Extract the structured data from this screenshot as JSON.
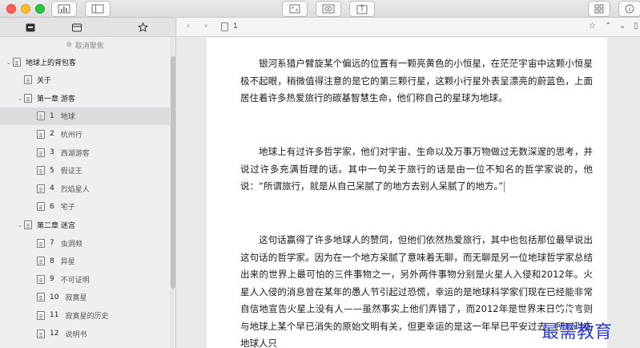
{
  "sidebar": {
    "unfocus_label": "取消聚焦",
    "tree": [
      {
        "label": "地球上的背包客",
        "level": 0,
        "chevron": "⌄",
        "selected": false
      },
      {
        "label": "关于",
        "level": 1,
        "chevron": "",
        "selected": false
      },
      {
        "label": "第一章 游客",
        "level": 1,
        "chevron": "⌄",
        "selected": false
      },
      {
        "num": "1",
        "label": "地球",
        "level": 2,
        "chevron": "",
        "selected": true
      },
      {
        "num": "2",
        "label": "杭州行",
        "level": 2,
        "chevron": "",
        "selected": false
      },
      {
        "num": "3",
        "label": "西湖游客",
        "level": 2,
        "chevron": "",
        "selected": false
      },
      {
        "num": "5",
        "label": "假证王",
        "level": 2,
        "chevron": "",
        "selected": false
      },
      {
        "num": "4",
        "label": "烈焰星人",
        "level": 2,
        "chevron": "",
        "selected": false
      },
      {
        "num": "6",
        "label": "宅子",
        "level": 2,
        "chevron": "",
        "selected": false
      },
      {
        "label": "第二章 迷宫",
        "level": 1,
        "chevron": "⌄",
        "selected": false
      },
      {
        "num": "7",
        "label": "虫洞频",
        "level": 2,
        "chevron": "",
        "selected": false
      },
      {
        "num": "8",
        "label": "异星",
        "level": 2,
        "chevron": "",
        "selected": false
      },
      {
        "num": "9",
        "label": "不可证明",
        "level": 2,
        "chevron": "",
        "selected": false
      },
      {
        "num": "10",
        "label": "寂寞星",
        "level": 2,
        "chevron": "",
        "selected": false
      },
      {
        "num": "11",
        "label": "寂寞星的历史",
        "level": 2,
        "chevron": "",
        "selected": false
      },
      {
        "num": "12",
        "label": "说明书",
        "level": 2,
        "chevron": "",
        "selected": false
      }
    ]
  },
  "editor": {
    "page_number": "1",
    "paragraphs": [
      "银河系猎户臂旋某个偏远的位置有一颗亮黄色的小恒星，在茫茫宇宙中这颗小恒星极不起眼，稍微值得注意的是它的第三颗行星，这颗小行星外表呈漂亮的蔚蓝色，上面居住着许多热爱旅行的碳基智慧生命，他们称自己的星球为地球。",
      "地球上有过许多哲学家，他们对宇宙、生命以及万事万物做过无数深邃的思考，并说过许多充满哲理的话。其中一句关于旅行的话是由一位不知名的哲学家说的，他说：“所谓旅行，就是从自己呆腻了的地方去别人呆腻了的地方。”",
      "这句话赢得了许多地球人的赞同，但他们依然热爱旅行，其中也包括那位最早说出这句话的哲学家。因为在一个地方呆腻了意味着无聊，而无聊是另一位地球哲学家总结出来的世界上最可怕的三件事物之一，另外两件事物分别是火星人入侵和2012年。火星人入侵的消息曾在某年的愚人节引起过恐慌，幸运的是地球科学家们现在已经能非常自信地宣告火星上没有人——虽然事实上他们弄错了，而2012年是世界末日的传言则与地球上某个早已消失的原始文明有关，但更幸运的是这一年早已平安过去，所以现在地球人只"
    ]
  },
  "watermark": {
    "text": "最需教育"
  }
}
